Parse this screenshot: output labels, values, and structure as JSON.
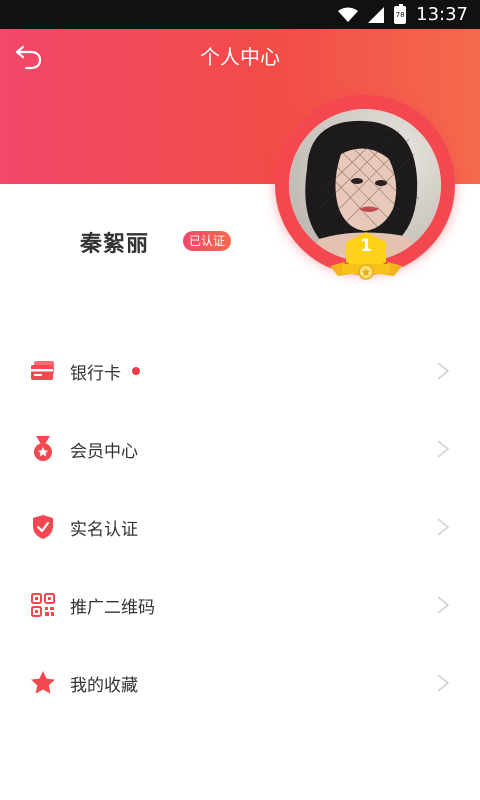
{
  "status_bar": {
    "time": "13:37",
    "battery": "78"
  },
  "header": {
    "title": "个人中心"
  },
  "profile": {
    "name": "秦絮丽",
    "badge": "已认证",
    "level": "1"
  },
  "menu": {
    "items": [
      {
        "label": "银行卡",
        "icon": "bank-card-icon",
        "has_dot": true
      },
      {
        "label": "会员中心",
        "icon": "medal-icon",
        "has_dot": false
      },
      {
        "label": "实名认证",
        "icon": "shield-check-icon",
        "has_dot": false
      },
      {
        "label": "推广二维码",
        "icon": "qr-code-icon",
        "has_dot": false
      },
      {
        "label": "我的收藏",
        "icon": "star-icon",
        "has_dot": false
      }
    ]
  },
  "colors": {
    "accent": "#f3484f",
    "gradient_start": "#f2486a",
    "gradient_end": "#f46a4d"
  }
}
